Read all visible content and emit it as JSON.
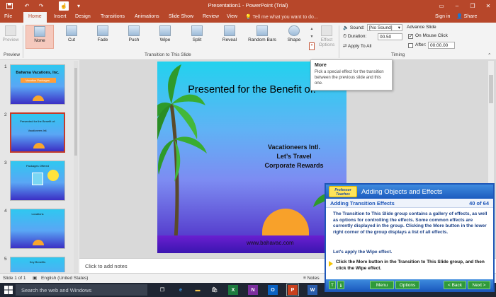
{
  "window": {
    "title": "Presentation1 - PowerPoint (Trial)",
    "signin": "Sign in",
    "share": "Share"
  },
  "tabs": [
    "File",
    "Home",
    "Insert",
    "Design",
    "Transitions",
    "Animations",
    "Slide Show",
    "Review",
    "View"
  ],
  "active_tab": "Home",
  "tellme": "Tell me what you want to do...",
  "ribbon": {
    "preview_label": "Preview",
    "preview_group": "Preview",
    "transitions": [
      "None",
      "Cut",
      "Fade",
      "Push",
      "Wipe",
      "Split",
      "Reveal",
      "Random Bars",
      "Shape"
    ],
    "selected_transition": "None",
    "transition_group": "Transition to This Slide",
    "effect_options": "Effect Options",
    "sound_label": "Sound:",
    "sound_value": "[No Sound]",
    "duration_label": "Duration:",
    "duration_value": "00.50",
    "apply_all": "Apply To All",
    "advance_label": "Advance Slide",
    "on_mouse_click": "On Mouse Click",
    "after_label": "After:",
    "after_value": "00:00.00",
    "timing_group": "Timing"
  },
  "tooltip": {
    "title": "More",
    "body": "Pick a special effect for the transition between the previous slide and this one."
  },
  "thumbnails": [
    {
      "num": "1",
      "title": "Bahama Vacations, Inc.",
      "sub": "Vacation Packages"
    },
    {
      "num": "2",
      "title": "Presented for the Benefit of:",
      "sub": "Vacationeers Intl."
    },
    {
      "num": "3",
      "title": "Packages Offered",
      "sub": ""
    },
    {
      "num": "4",
      "title": "Locations",
      "sub": ""
    },
    {
      "num": "5",
      "title": "Key Benefits",
      "sub": ""
    }
  ],
  "slide": {
    "title": "Presented for the Benefit of:",
    "lines": [
      "Vacationeers Intl.",
      "Let’s Travel",
      "Corporate Rewards"
    ],
    "url": "www.bahavac.com"
  },
  "notes_placeholder": "Click to add notes",
  "status": {
    "slide": "Slide 1 of 1",
    "language": "English (United States)",
    "notes": "Notes"
  },
  "taskbar": {
    "search_placeholder": "Search the web and Windows",
    "apps": [
      {
        "label": "X",
        "color": "#1d7a3e"
      },
      {
        "label": "N",
        "color": "#7b2f9e"
      },
      {
        "label": "O",
        "color": "#0a62c2"
      },
      {
        "label": "P",
        "color": "#c8401d"
      },
      {
        "label": "W",
        "color": "#2a5caa"
      }
    ]
  },
  "tutorial": {
    "logo": "Professor Teaches",
    "title": "Adding Objects and Effects",
    "subtitle": "Adding Transition Effects",
    "progress": "40 of 64",
    "para1": "The Transition to This Slide group contains a gallery of effects, as well as options for controlling the effects. Some common effects are currently displayed in the group. Clicking the More button in the lower right corner of the group displays a list of all effects.",
    "para2": "Let's apply the Wipe effect.",
    "instruction": "Click the More button in the Transition to This Slide group, and then click the Wipe effect.",
    "buttons": {
      "t": "T",
      "menu": "Menu",
      "options": "Options",
      "back": "< Back",
      "next": "Next >"
    }
  }
}
